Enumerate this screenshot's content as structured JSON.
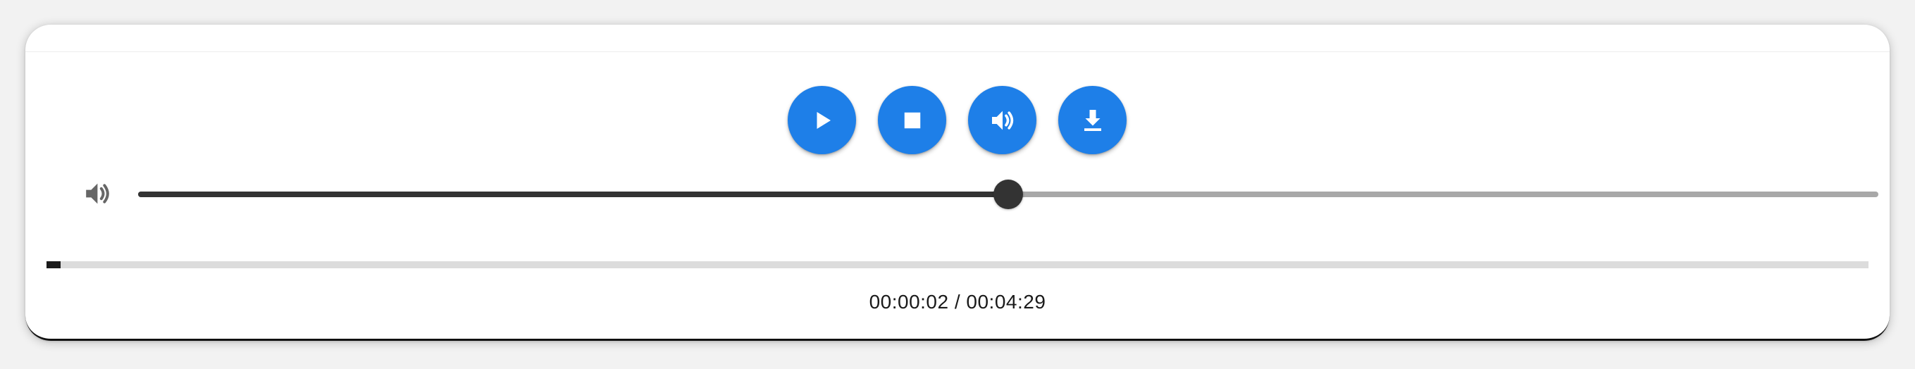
{
  "player": {
    "controls": [
      {
        "name": "play-button",
        "icon": "play-icon"
      },
      {
        "name": "stop-button",
        "icon": "stop-icon"
      },
      {
        "name": "mute-toggle-button",
        "icon": "speaker-icon"
      },
      {
        "name": "download-button",
        "icon": "download-icon"
      }
    ],
    "volume": {
      "icon": "speaker-icon",
      "level": 0.5
    },
    "progress": {
      "fraction": 0.0078
    },
    "time": {
      "current": "00:00:02",
      "total": "00:04:29",
      "display": "00:00:02 / 00:04:29"
    },
    "colors": {
      "accent": "#1e7fe8",
      "slider_active": "#333333",
      "slider_inactive": "#a8a8a8",
      "progress_fill": "#1a1a1a",
      "progress_track": "#dcdcdc"
    }
  }
}
